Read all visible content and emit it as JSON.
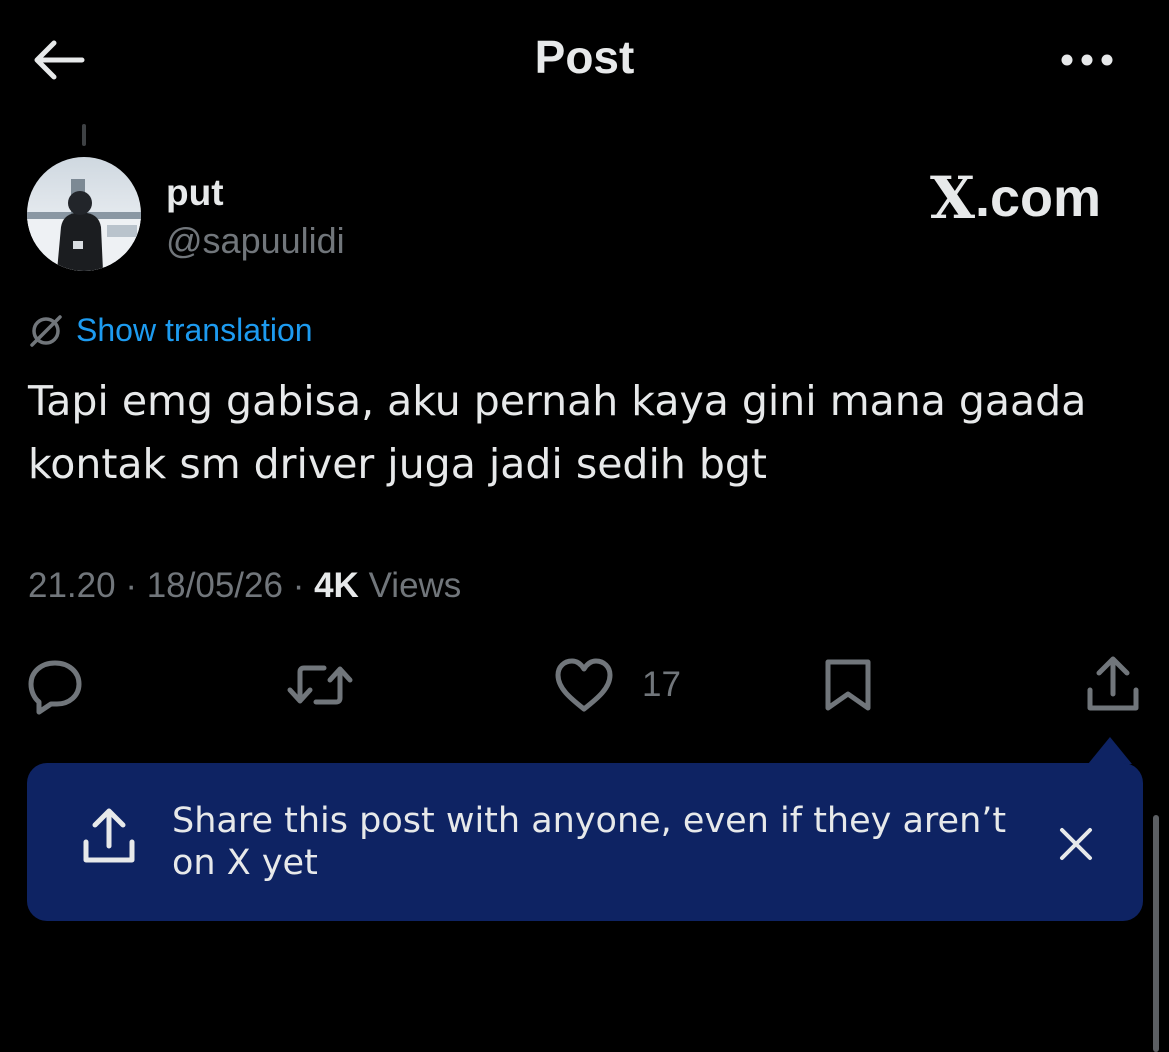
{
  "header": {
    "title": "Post",
    "back_icon": "arrow-left-icon",
    "more_icon": "more-horizontal-icon"
  },
  "author": {
    "display_name": "put",
    "handle": "@sapuulidi"
  },
  "watermark": {
    "x_glyph": "X",
    "suffix": ".com"
  },
  "translation": {
    "label": "Show translation",
    "icon": "translate-icon"
  },
  "post": {
    "text": "Tapi emg gabisa, aku pernah kaya gini mana gaada kontak sm driver juga jadi sedih bgt",
    "time": "21.20",
    "date": "18/05/26",
    "views_count": "4K",
    "views_label": "Views"
  },
  "actions": {
    "like_count": "17"
  },
  "tooltip": {
    "text": "Share this post with anyone, even if they aren’t on X yet"
  },
  "colors": {
    "background": "#000000",
    "text": "#e7e9ea",
    "muted": "#71767b",
    "link": "#1d9bf0",
    "tooltip_bg": "#0e2363"
  }
}
